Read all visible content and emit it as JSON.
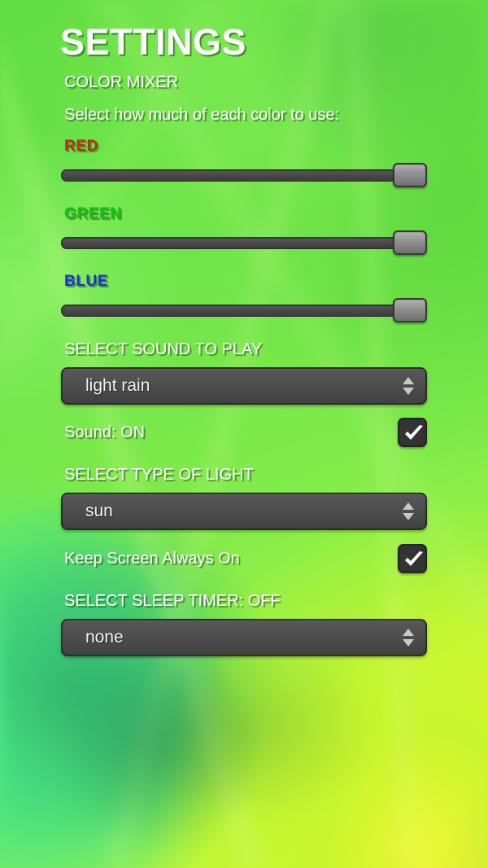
{
  "app": {
    "title": "SETTINGS",
    "section_heading": "COLOR MIXER",
    "instruction": "Select how much of each color to use:"
  },
  "colors": {
    "red_label_color": "#c42b14",
    "green_label_color": "#13c40f",
    "blue_label_color": "#1b32d8",
    "text_color": "#ffffff",
    "control_fill": "#4c4c4c",
    "control_border": "#2b2b2b",
    "thumb_fill": "#8e8e8e",
    "background_green": "#6ce348",
    "background_yellow": "#d9f933"
  },
  "sliders": [
    {
      "label": "RED",
      "value": 93,
      "min": 0,
      "max": 100
    },
    {
      "label": "GREEN",
      "value": 93,
      "min": 0,
      "max": 100
    },
    {
      "label": "BLUE",
      "value": 93,
      "min": 0,
      "max": 100
    }
  ],
  "sound_section": {
    "label": "SELECT SOUND TO PLAY",
    "selected": "light rain",
    "spinner_up_icon": "triangle-up-icon",
    "spinner_down_icon": "triangle-down-icon"
  },
  "sound_toggle": {
    "label": "Sound: ON",
    "checked": true,
    "check_icon": "checkmark-icon"
  },
  "light_section": {
    "label": "SELECT TYPE OF LIGHT",
    "selected": "sun"
  },
  "screen_toggle": {
    "label": "Keep Screen Always On",
    "checked": true,
    "check_icon": "checkmark-icon"
  },
  "sleep_section": {
    "label": "SELECT SLEEP TIMER: OFF",
    "selected": "none"
  }
}
